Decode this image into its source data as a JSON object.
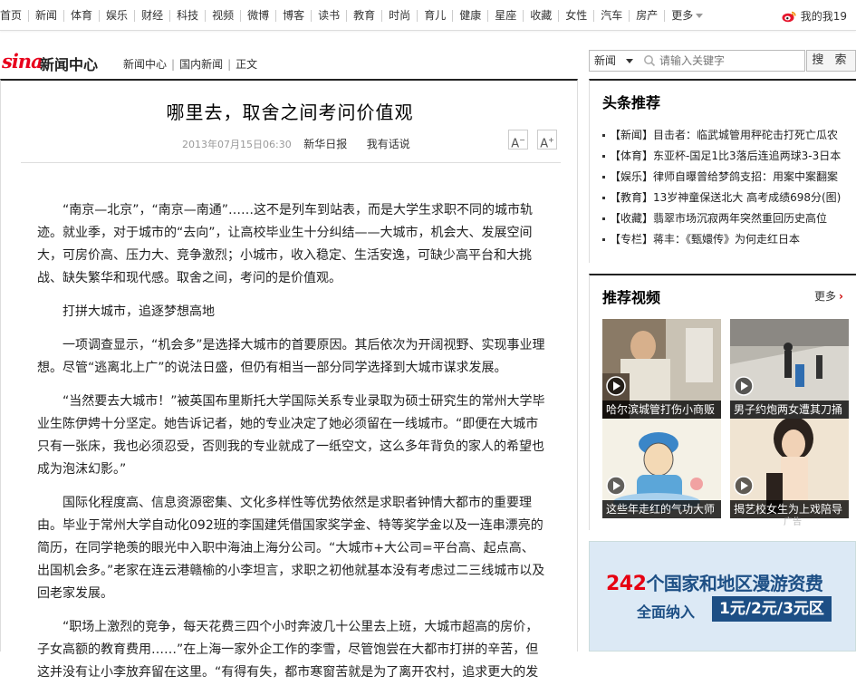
{
  "topnav": {
    "items": [
      "首页",
      "新闻",
      "体育",
      "娱乐",
      "财经",
      "科技",
      "视频",
      "微博",
      "博客",
      "读书",
      "教育",
      "时尚",
      "育儿",
      "健康",
      "星座",
      "收藏",
      "女性",
      "汽车",
      "房产"
    ],
    "more_label": "更多",
    "weibo_label": "我的我19"
  },
  "logo": {
    "sina": "sina",
    "label": "新闻中心"
  },
  "breadcrumb": {
    "items": [
      "新闻中心",
      "国内新闻",
      "正文"
    ]
  },
  "search": {
    "category": "新闻",
    "placeholder": "请输入关键字",
    "button": "搜 索"
  },
  "article": {
    "title": "哪里去，取舍之间考问价值观",
    "date": "2013年07月15日06:30",
    "source": "新华日报",
    "comment": "我有话说",
    "font_small": "A",
    "font_large": "A",
    "paragraphs": [
      "“南京—北京”，“南京—南通”……这不是列车到站表，而是大学生求职不同的城市轨迹。就业季，对于城市的“去向”，让高校毕业生十分纠结——大城市，机会大、发展空间大，可房价高、压力大、竞争激烈；小城市，收入稳定、生活安逸，可缺少高平台和大挑战、缺失繁华和现代感。取舍之间，考问的是价值观。",
      "打拼大城市，追逐梦想高地",
      "一项调查显示，“机会多”是选择大城市的首要原因。其后依次为开阔视野、实现事业理想。尽管“逃离北上广”的说法日盛，但仍有相当一部分同学选择到大城市谋求发展。",
      "“当然要去大城市！”被英国布里斯托大学国际关系专业录取为硕士研究生的常州大学毕业生陈伊娉十分坚定。她告诉记者，她的专业决定了她必须留在一线城市。“即便在大城市只有一张床，我也必须忍受，否则我的专业就成了一纸空文，这么多年背负的家人的希望也成为泡沫幻影。”",
      "国际化程度高、信息资源密集、文化多样性等优势依然是求职者钟情大都市的重要理由。毕业于常州大学自动化092班的李国建凭借国家奖学金、特等奖学金以及一连串漂亮的简历，在同学艳羡的眼光中入职中海油上海分公司。“大城市+大公司=平台高、起点高、出国机会多。”老家在连云港赣榆的小李坦言，求职之初他就基本没有考虑过二三线城市以及回老家发展。",
      "“职场上激烈的竞争，每天花费三四个小时奔波几十公里去上班，大城市超高的房价，子女高额的教育费用……”在上海一家外企工作的李雪，尽管饱尝在大都市打拼的辛苦，但这并没有让小李放弃留在这里。“有得有失，都市寒窗苦就是为了离开农村，追求更大的发"
    ]
  },
  "headlines": {
    "title": "头条推荐",
    "items": [
      "【新闻】目击者：临武城管用秤砣击打死亡瓜农",
      "【体育】东亚杯-国足1比3落后连追两球3-3日本",
      "【娱乐】律师自曝曾给梦鸽支招：用案中案翻案",
      "【教育】13岁神童保送北大 高考成绩698分(图)",
      "【收藏】翡翠市场沉寂两年突然重回历史高位",
      "【专栏】蒋丰：《甄嬛传》为何走红日本"
    ]
  },
  "videos": {
    "title": "推荐视频",
    "more": "更多",
    "items": [
      {
        "caption": "哈尔滨城管打伤小商贩"
      },
      {
        "caption": "男子约炮两女遭其刀捅"
      },
      {
        "caption": "这些年走红的气功大师"
      },
      {
        "caption": "揭艺校女生为上戏陪导"
      }
    ],
    "ad_mark": "广告"
  },
  "ad": {
    "number": "242",
    "line1_rest": "个国家和地区漫游资费",
    "line2": "全面纳入",
    "price": "1元/2元/3元区"
  },
  "colors": {
    "accent_red": "#e8001c",
    "ad_blue": "#1d4f85"
  }
}
